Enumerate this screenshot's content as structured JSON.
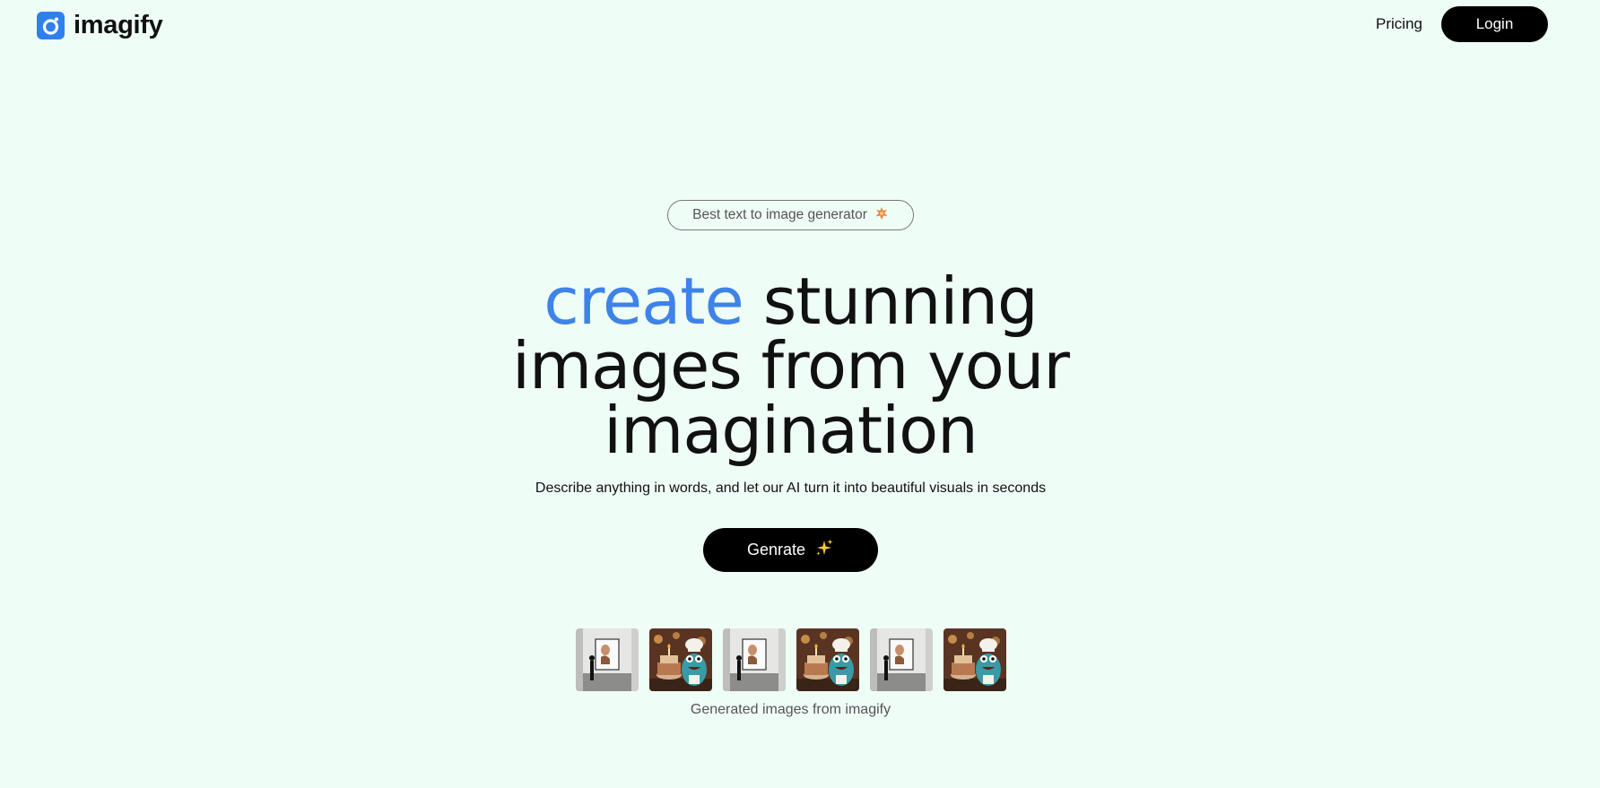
{
  "header": {
    "logo_text": "imagify",
    "logo_icon": "camera-lens-icon",
    "nav": {
      "pricing_label": "Pricing",
      "login_label": "Login"
    }
  },
  "hero": {
    "badge_text": "Best text to image generator",
    "badge_icon": "star-burst-icon",
    "headline_accent": "create",
    "headline_rest_line1": " stunning",
    "headline_line2": "images from your",
    "headline_line3": "imagination",
    "subtitle": "Describe anything in words, and let our AI turn it into beautiful visuals in seconds",
    "generate_label": "Genrate",
    "generate_icon": "sparkles-icon"
  },
  "gallery": {
    "images": [
      "gallery-portrait",
      "monster-chef-cake",
      "gallery-portrait",
      "monster-chef-cake",
      "gallery-portrait",
      "monster-chef-cake"
    ],
    "caption": "Generated images from imagify"
  },
  "colors": {
    "background": "#effdf7",
    "accent": "#3d83e8",
    "logo": "#2f80ed",
    "button": "#000000"
  }
}
